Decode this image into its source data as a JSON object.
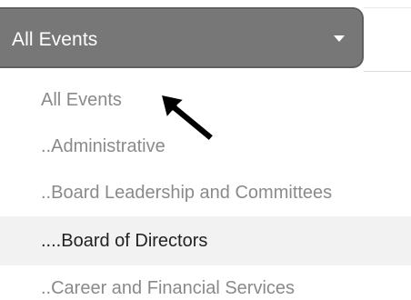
{
  "dropdown": {
    "selected": "All Events",
    "caret_icon": "caret-down-icon",
    "options": [
      {
        "label": "All Events",
        "highlighted": false
      },
      {
        "label": "..Administrative",
        "highlighted": false
      },
      {
        "label": "..Board Leadership and Committees",
        "highlighted": false
      },
      {
        "label": "....Board of Directors",
        "highlighted": true
      },
      {
        "label": "..Career and Financial Services",
        "highlighted": false
      }
    ]
  },
  "cursor": {
    "icon": "mouse-pointer-icon"
  },
  "colors": {
    "select_background": "#777777",
    "select_text": "#ffffff",
    "option_text": "#8a8a8a",
    "highlight_background": "#f2f2f2",
    "highlight_text": "#222222"
  }
}
